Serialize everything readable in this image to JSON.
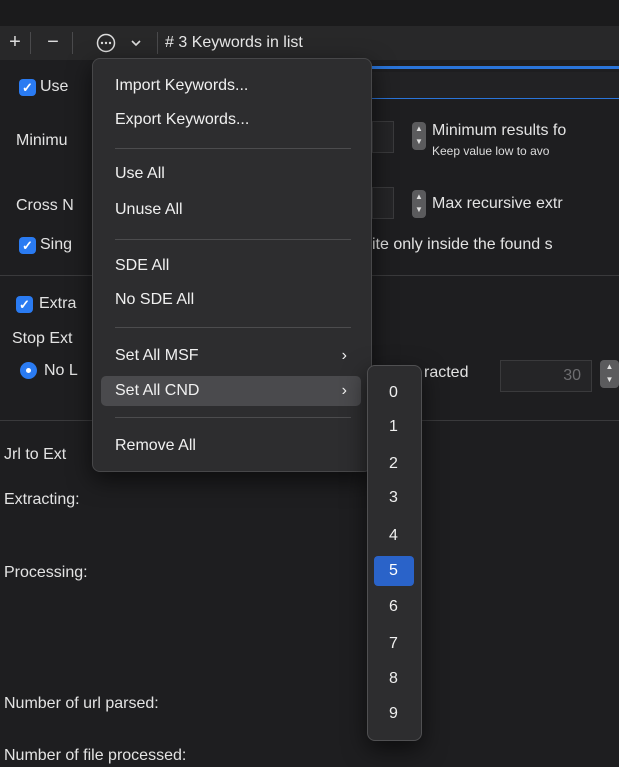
{
  "toolbar": {
    "add_label": "+",
    "remove_label": "−",
    "actions_icon": "ellipsis-circle-icon",
    "dropdown_icon": "chevron-down-icon",
    "title": "# 3 Keywords in list"
  },
  "settings": {
    "use_label": "Use",
    "minimum_label": "Minimu",
    "minimum_results_label": "Minimum results fo",
    "minimum_results_hint": "Keep value low to avo",
    "cross_label": "Cross N",
    "max_recursive_label": "Max recursive extr",
    "single_label": "Sing",
    "single_tail": "ite only inside the found s",
    "extract_label": "Extra",
    "stop_label": "Stop Ext",
    "no_label": "No L",
    "extracted_label": "racted",
    "extracted_value": "30"
  },
  "status": {
    "url_label": "Jrl to Ext",
    "extracting_label": "Extracting:",
    "processing_label": "Processing:",
    "url_parsed_label": "Number of url parsed:",
    "file_processed_label": "Number of file processed:"
  },
  "menu": {
    "import": "Import Keywords...",
    "export": "Export Keywords...",
    "use_all": "Use All",
    "unuse_all": "Unuse All",
    "sde_all": "SDE All",
    "no_sde_all": "No SDE All",
    "set_all_msf": "Set All MSF",
    "set_all_cnd": "Set All CND",
    "remove_all": "Remove All",
    "submenu_chevron": "›"
  },
  "submenu": {
    "items": [
      "0",
      "1",
      "2",
      "3",
      "4",
      "5",
      "6",
      "7",
      "8",
      "9"
    ],
    "selected": "5"
  },
  "colors": {
    "accent": "#2a7bf2",
    "selection": "#2a63c9",
    "background": "#1e1e20"
  }
}
